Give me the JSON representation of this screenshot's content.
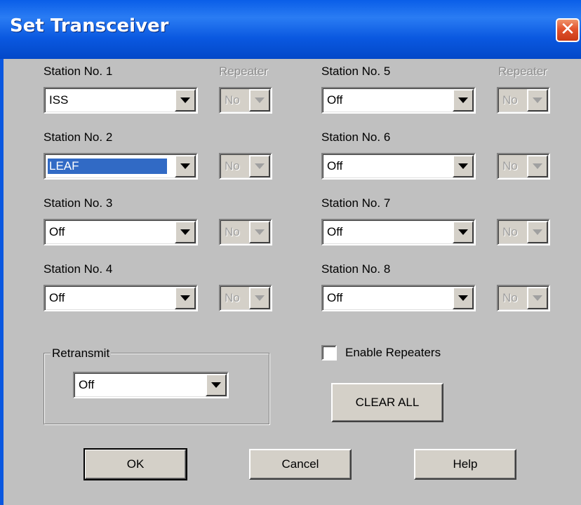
{
  "window": {
    "title": "Set Transceiver",
    "close_glyph": "✕"
  },
  "repeater_label": "Repeater",
  "stations": [
    {
      "label": "Station No. 1",
      "value": "ISS",
      "repeater": "No"
    },
    {
      "label": "Station No. 2",
      "value": "LEAF",
      "repeater": "No"
    },
    {
      "label": "Station No. 3",
      "value": "Off",
      "repeater": "No"
    },
    {
      "label": "Station No. 4",
      "value": "Off",
      "repeater": "No"
    },
    {
      "label": "Station No. 5",
      "value": "Off",
      "repeater": "No"
    },
    {
      "label": "Station No. 6",
      "value": "Off",
      "repeater": "No"
    },
    {
      "label": "Station No. 7",
      "value": "Off",
      "repeater": "No"
    },
    {
      "label": "Station No. 8",
      "value": "Off",
      "repeater": "No"
    }
  ],
  "retransmit": {
    "label": "Retransmit",
    "value": "Off"
  },
  "enable_repeaters": {
    "label": "Enable Repeaters",
    "checked": false
  },
  "buttons": {
    "clear_all": "CLEAR ALL",
    "ok": "OK",
    "cancel": "Cancel",
    "help": "Help"
  }
}
